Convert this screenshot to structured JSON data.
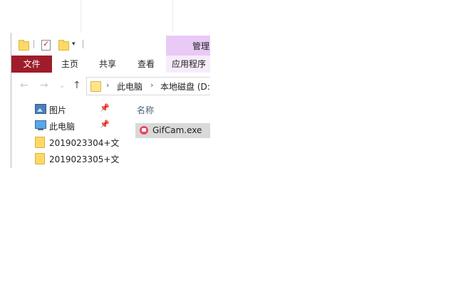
{
  "ribbon": {
    "manage_label": "管理",
    "tabs": [
      "文件",
      "主页",
      "共享",
      "查看"
    ],
    "app_tools_label": "应用程序"
  },
  "address": {
    "crumbs": [
      "此电脑",
      "本地磁盘 (D:)"
    ]
  },
  "navpane": {
    "items": [
      {
        "label": "图片",
        "icon": "pictures-icon",
        "pinned": true
      },
      {
        "label": "此电脑",
        "icon": "pc-icon",
        "pinned": true
      },
      {
        "label": "2019023304+文",
        "icon": "folder-icon",
        "pinned": false
      },
      {
        "label": "2019023305+文",
        "icon": "folder-icon",
        "pinned": false
      }
    ]
  },
  "content": {
    "column_name": "名称",
    "files": [
      {
        "name": "GifCam.exe",
        "icon": "gifcam-app-icon",
        "selected": true
      }
    ]
  },
  "colors": {
    "file_tab": "#9f1c2b",
    "manage_tab": "#e9c9f6",
    "selection": "#d9d9d9"
  }
}
